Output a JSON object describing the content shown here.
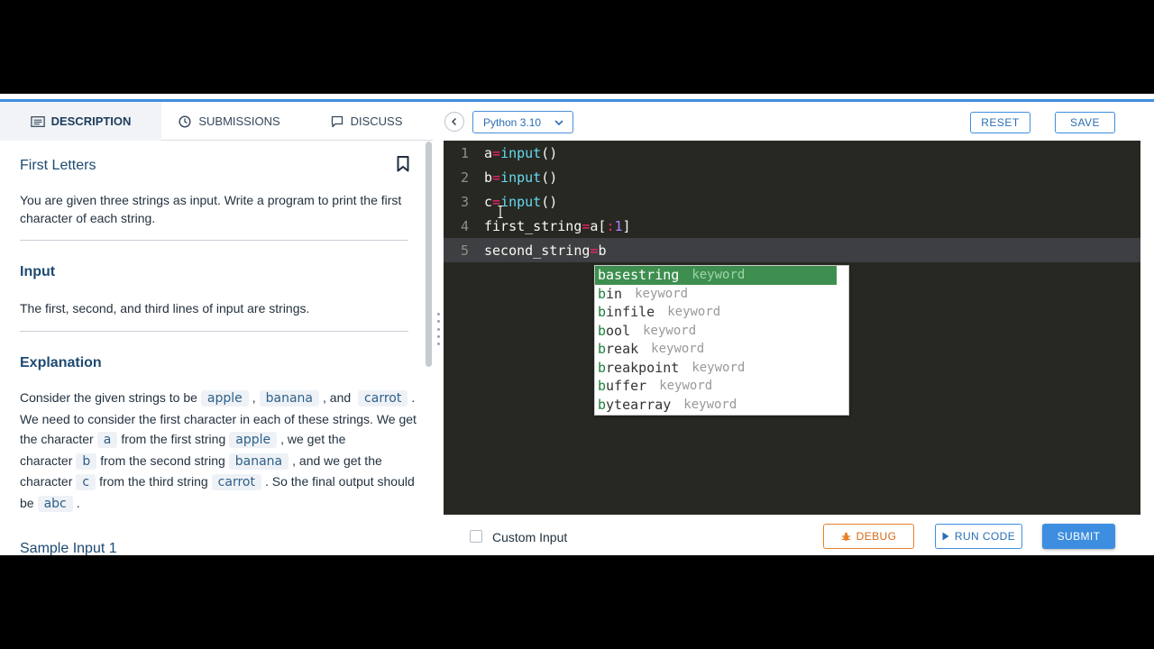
{
  "tabs": {
    "description": "DESCRIPTION",
    "submissions": "SUBMISSIONS",
    "discuss": "DISCUSS"
  },
  "problem": {
    "title": "First Letters",
    "intro": "You are given three strings as input. Write a program to print the first character of each string.",
    "input_heading": "Input",
    "input_text": "The first, second, and third lines of input are strings.",
    "explanation_heading": "Explanation",
    "explanation": {
      "t1": "Consider the given strings to be",
      "c1": "apple",
      "t2": ",",
      "c2": "banana",
      "t3": ", and",
      "c3": "carrot",
      "t4": ". We need to consider the first character in each of these strings. We get the character",
      "c4": "a",
      "t5": "from the first string",
      "c5": "apple",
      "t6": ", we get the character",
      "c6": "b",
      "t7": "from the second string",
      "c7": "banana",
      "t8": ", and we get the character",
      "c8": "c",
      "t9": "from the third string",
      "c9": "carrot",
      "t10": ". So the final output should be",
      "c10": "abc",
      "t11": "."
    },
    "sample_heading": "Sample Input 1"
  },
  "toolbar": {
    "language": "Python 3.10",
    "reset": "RESET",
    "save": "SAVE"
  },
  "editor": {
    "lines": [
      {
        "n": "1",
        "var": "a",
        "op": "=",
        "fn": "input",
        "rest": "()"
      },
      {
        "n": "2",
        "var": "b",
        "op": "=",
        "fn": "input",
        "rest": "()"
      },
      {
        "n": "3",
        "var": "c",
        "op": "=",
        "fn": "input",
        "rest": "()"
      },
      {
        "n": "4",
        "var": "first_string",
        "op": "=",
        "pre": "a[",
        "op2": ":",
        "num": "1",
        "post": "]"
      },
      {
        "n": "5",
        "var": "second_string",
        "op": "=",
        "rest": "b"
      }
    ],
    "autocomplete": [
      {
        "match": "b",
        "rest": "asestring",
        "type": "keyword"
      },
      {
        "match": "b",
        "rest": "in",
        "type": "keyword"
      },
      {
        "match": "b",
        "rest": "infile",
        "type": "keyword"
      },
      {
        "match": "b",
        "rest": "ool",
        "type": "keyword"
      },
      {
        "match": "b",
        "rest": "reak",
        "type": "keyword"
      },
      {
        "match": "b",
        "rest": "reakpoint",
        "type": "keyword"
      },
      {
        "match": "b",
        "rest": "uffer",
        "type": "keyword"
      },
      {
        "match": "b",
        "rest": "ytearray",
        "type": "keyword"
      }
    ]
  },
  "bottom": {
    "custom_input": "Custom Input",
    "debug": "DEBUG",
    "run_code": "RUN CODE",
    "submit": "SUBMIT"
  },
  "colors": {
    "accent": "#3d8ee0",
    "editor_bg": "#272822",
    "autocomplete_selected": "#3e8f4f",
    "debug": "#e8802c"
  }
}
